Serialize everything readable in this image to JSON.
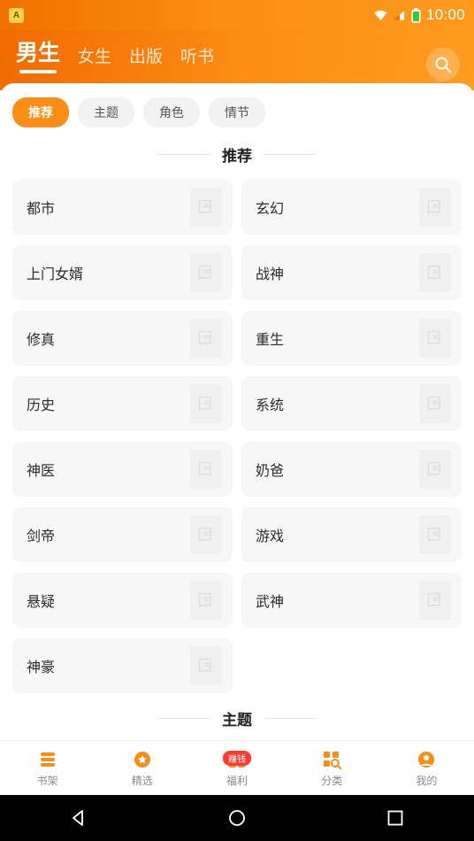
{
  "statusbar": {
    "app_badge": "A",
    "clock": "10:00",
    "icons": [
      "wifi-icon",
      "signal-icon",
      "battery-icon"
    ]
  },
  "header": {
    "tabs": [
      {
        "label": "男生",
        "active": true
      },
      {
        "label": "女生",
        "active": false
      },
      {
        "label": "出版",
        "active": false
      },
      {
        "label": "听书",
        "active": false
      }
    ],
    "search_icon": "search-icon"
  },
  "filter_chips": [
    {
      "label": "推荐",
      "active": true
    },
    {
      "label": "主题",
      "active": false
    },
    {
      "label": "角色",
      "active": false
    },
    {
      "label": "情节",
      "active": false
    }
  ],
  "sections": [
    {
      "title": "推荐"
    },
    {
      "title": "主题"
    }
  ],
  "categories": [
    {
      "name": "都市"
    },
    {
      "name": "玄幻"
    },
    {
      "name": "上门女婿"
    },
    {
      "name": "战神"
    },
    {
      "name": "修真"
    },
    {
      "name": "重生"
    },
    {
      "name": "历史"
    },
    {
      "name": "系统"
    },
    {
      "name": "神医"
    },
    {
      "name": "奶爸"
    },
    {
      "name": "剑帝"
    },
    {
      "name": "游戏"
    },
    {
      "name": "悬疑"
    },
    {
      "name": "武神"
    },
    {
      "name": "神豪"
    }
  ],
  "tabbar": [
    {
      "label": "书架",
      "icon": "bookshelf-icon",
      "active": false,
      "badge": ""
    },
    {
      "label": "精选",
      "icon": "star-icon",
      "active": false,
      "badge": ""
    },
    {
      "label": "福利",
      "icon": "gift-icon",
      "active": false,
      "badge": "赚钱"
    },
    {
      "label": "分类",
      "icon": "grid-search-icon",
      "active": false,
      "badge": ""
    },
    {
      "label": "我的",
      "icon": "user-icon",
      "active": false,
      "badge": ""
    }
  ],
  "navbar": [
    {
      "icon": "back-triangle-icon"
    },
    {
      "icon": "home-circle-icon"
    },
    {
      "icon": "recents-square-icon"
    }
  ],
  "colors": {
    "brand_orange": "#fb8c14",
    "header_gradient_start": "#f26a00",
    "header_gradient_end": "#ff9c22",
    "card_bg": "#f7f7f7",
    "badge_red": "#ff3b30"
  }
}
